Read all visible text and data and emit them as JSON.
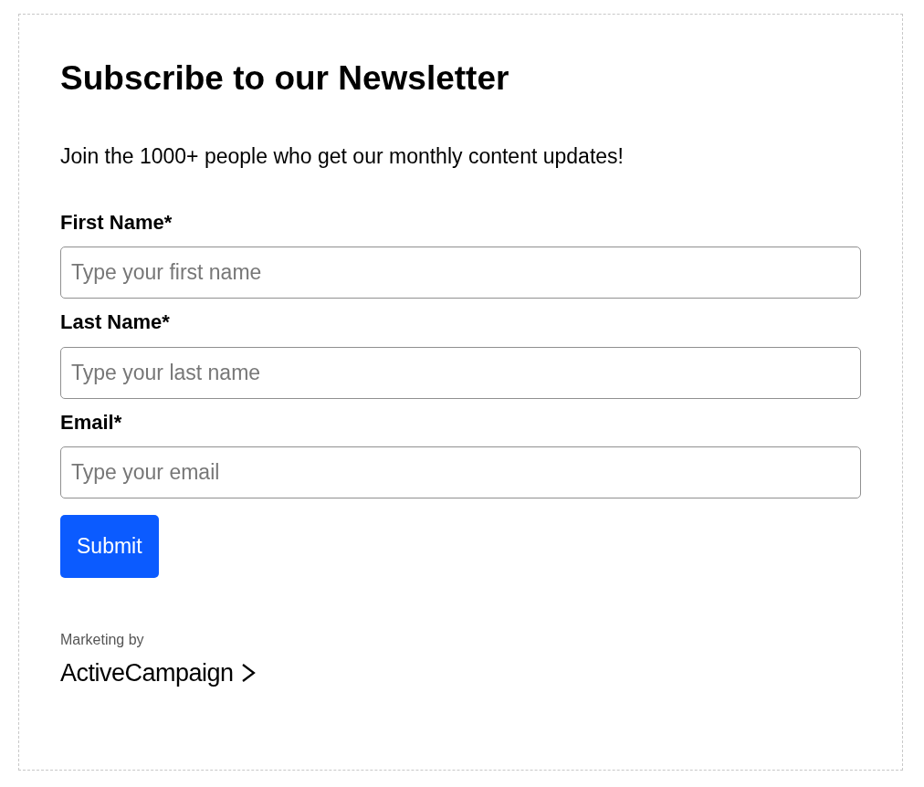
{
  "form": {
    "title": "Subscribe to our Newsletter",
    "description": "Join the 1000+ people who get our monthly content updates!",
    "fields": [
      {
        "label": "First Name*",
        "placeholder": "Type your first name"
      },
      {
        "label": "Last Name*",
        "placeholder": "Type your last name"
      },
      {
        "label": "Email*",
        "placeholder": "Type your email"
      }
    ],
    "submit": "Submit"
  },
  "footer": {
    "caption": "Marketing by",
    "brand": "ActiveCampaign"
  }
}
